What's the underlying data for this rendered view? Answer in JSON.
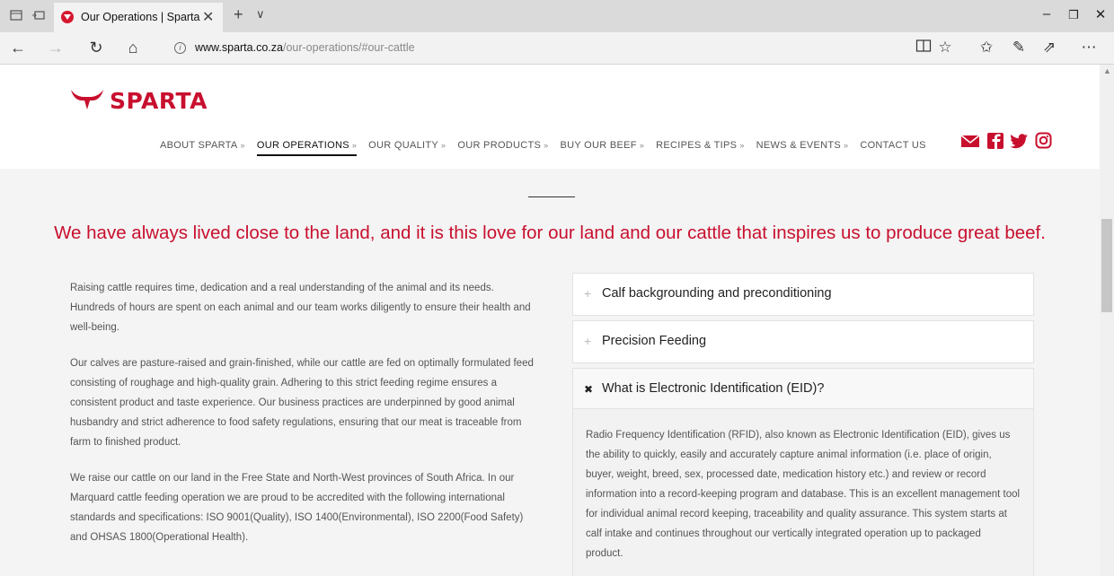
{
  "browser": {
    "tab_title": "Our Operations | Sparta",
    "tab_close": "✕",
    "new_tab": "+",
    "tab_dropdown": "∨",
    "url_domain": "www.sparta.co.za",
    "url_path": "/our-operations/#our-cattle",
    "info": "i",
    "window": {
      "minimize": "–",
      "restore": "❐",
      "close": "✕"
    },
    "nav": {
      "back": "←",
      "forward": "→",
      "refresh": "↻",
      "home": "⌂"
    },
    "tools": {
      "reading": "📖",
      "favorite": "☆",
      "favorites_hub": "✩",
      "notes": "✎",
      "share": "⇗",
      "more": "⋯"
    },
    "brand_color": "#d6162f"
  },
  "site": {
    "logo_text": "SPARTA",
    "brand_color": "#c8102e",
    "nav": [
      {
        "label": "ABOUT SPARTA",
        "chev": "»"
      },
      {
        "label": "OUR OPERATIONS",
        "chev": "»"
      },
      {
        "label": "OUR QUALITY",
        "chev": "»"
      },
      {
        "label": "OUR PRODUCTS",
        "chev": "»"
      },
      {
        "label": "BUY OUR BEEF",
        "chev": "»"
      },
      {
        "label": "RECIPES & TIPS",
        "chev": "»"
      },
      {
        "label": "NEWS & EVENTS",
        "chev": "»"
      },
      {
        "label": "CONTACT US",
        "chev": ""
      }
    ],
    "active_nav": "OUR OPERATIONS",
    "social": [
      "email-icon",
      "facebook-icon",
      "twitter-icon",
      "instagram-icon"
    ]
  },
  "content": {
    "tagline": "We have always lived close to the land, and it is this love for our land and our cattle that inspires us to produce great beef.",
    "paragraphs": [
      "Raising cattle requires time, dedication and a real understanding of the animal and its needs. Hundreds of hours are spent on each animal and our team works diligently to ensure their health and well-being.",
      "Our calves are pasture-raised and grain-finished, while our cattle are fed on optimally formulated feed consisting of roughage and high-quality grain. Adhering to this strict feeding regime ensures a consistent product and taste experience. Our business practices are underpinned by good animal husbandry and strict adherence to food safety regulations, ensuring that our meat is traceable from farm to finished product.",
      "We raise our cattle on our land in the Free State and North-West provinces of South Africa. In our Marquard cattle feeding operation we are proud to be accredited with the following international standards and specifications: ISO 9001(Quality), ISO 1400(Environmental), ISO 2200(Food Safety) and OHSAS 1800(Operational Health)."
    ],
    "accordion": [
      {
        "toggle": "+",
        "title": "Calf backgrounding and preconditioning"
      },
      {
        "toggle": "+",
        "title": "Precision Feeding"
      },
      {
        "toggle": "✖",
        "title": "What is Electronic Identification (EID)?"
      }
    ],
    "accordion_open_body": "Radio Frequency Identification (RFID), also known as Electronic Identification (EID), gives us the ability to quickly, easily and accurately capture animal information (i.e. place of origin, buyer, weight, breed, sex, processed date, medication history etc.) and review or record information into a record-keeping program and database. This is an excellent management tool for individual animal record keeping, traceability and quality assurance. This system starts at calf intake and continues throughout our vertically integrated operation up to packaged product."
  }
}
